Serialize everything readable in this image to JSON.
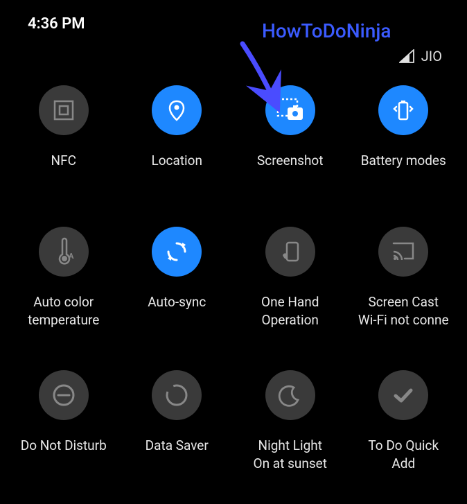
{
  "status": {
    "time": "4:36 PM",
    "carrier": "JIO"
  },
  "watermark": "HowToDoNinja",
  "tiles": [
    {
      "label": "NFC",
      "sub": "",
      "active": false,
      "icon": "nfc"
    },
    {
      "label": "Location",
      "sub": "",
      "active": true,
      "icon": "location"
    },
    {
      "label": "Screenshot",
      "sub": "",
      "active": true,
      "icon": "screenshot"
    },
    {
      "label": "Battery modes",
      "sub": "",
      "active": true,
      "icon": "battery"
    },
    {
      "label": "Auto color",
      "sub": "temperature",
      "active": false,
      "icon": "autocolor"
    },
    {
      "label": "Auto-sync",
      "sub": "",
      "active": true,
      "icon": "sync"
    },
    {
      "label": "One Hand",
      "sub": "Operation",
      "active": false,
      "icon": "onehand"
    },
    {
      "label": "Screen Cast",
      "sub": "Wi-Fi not conne",
      "active": false,
      "icon": "cast"
    },
    {
      "label": "Do Not Disturb",
      "sub": "",
      "active": false,
      "icon": "dnd"
    },
    {
      "label": "Data Saver",
      "sub": "",
      "active": false,
      "icon": "datasaver"
    },
    {
      "label": "Night Light",
      "sub": "On at sunset",
      "active": false,
      "icon": "nightlight"
    },
    {
      "label": "To Do Quick",
      "sub": "Add",
      "active": false,
      "icon": "todo"
    }
  ]
}
